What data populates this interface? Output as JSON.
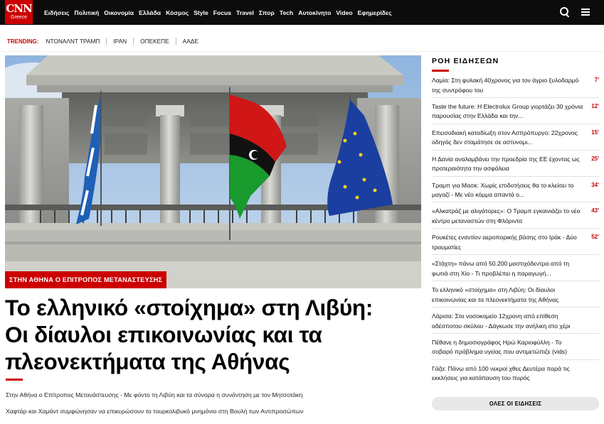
{
  "logo": {
    "brand": "CNN",
    "edition": "Greece"
  },
  "nav": {
    "items": [
      "Ειδήσεις",
      "Πολιτική",
      "Οικονομία",
      "Ελλάδα",
      "Κόσμος",
      "Style",
      "Focus",
      "Travel",
      "Σπορ",
      "Tech",
      "Αυτοκίνητο",
      "Video",
      "Εφημερίδες"
    ]
  },
  "icons": {
    "search": "search-icon",
    "menu": "hamburger-menu-icon"
  },
  "colors": {
    "accent": "#cc0000",
    "nav_bg": "#0c0c0c"
  },
  "trending": {
    "label": "TRENDING:",
    "items": [
      "ΝΤΟΝΑΛΝΤ ΤΡΑΜΠ",
      "ΙΡΑΝ",
      "ΟΠΕΚΕΠΕ",
      "ΑΑΔΕ"
    ]
  },
  "main": {
    "kicker": "ΣΤΗΝ ΑΘΗΝΑ Ο ΕΠΙΤΡΟΠΟΣ ΜΕΤΑΝΑΣΤΕΥΣΗΣ",
    "headline_lines": [
      "Το ελληνικό «στοίχημα» στη Λιβύη:",
      "Οι δίαυλοι επικοινωνίας και τα",
      "πλεονεκτήματα της Αθήνας"
    ],
    "summary_lines": [
      "Στην Αθήνα ο Επίτροπος Μετανάστευσης - Με φόντο τη Λιβύη και τα σύνορα η συνάντηση με τον Μητσοτάκη",
      "Χαφτάρ και Χαμάντ συμφώνησαν να επικυρώσουν το τουρκολιβυκό μνημόνιο στη Βουλή των Αντιπροσώπων"
    ]
  },
  "feed": {
    "title": "ΡΟΗ ΕΙΔΗΣΕΩΝ",
    "items": [
      {
        "text": "Λαμία: Στη φυλακή 40χρονος για τον άγριο ξυλοδαρμό της συντρόφου του",
        "minutes": "7'"
      },
      {
        "text": "Taste the future: Η Electrolux Group γιορτάζει 30 χρόνια παρουσίας στην Ελλάδα και την...",
        "minutes": "12'"
      },
      {
        "text": "Επεισοδιακή καταδίωξη στον Ασπρόπυργο: 22χρονος οδηγός δεν σταμάτησε σε αστυνομι...",
        "minutes": "15'"
      },
      {
        "text": "Η Δανία αναλαμβάνει την προεδρία της ΕΕ έχοντας ως προτεραιότητα την ασφάλεια",
        "minutes": "25'"
      },
      {
        "text": "Τραμπ για Μασκ: Χωρίς επιδοτήσεις θα το κλείσει το μαγαζί - Με νέο κόμμα απαντά ο...",
        "minutes": "34'"
      },
      {
        "text": "«Αλκατράζ με αλιγάτορες»: Ο Τραμπ εγκαινιάζει το νέο κέντρο μεταναστών στη Φλόριντα",
        "minutes": "43'"
      },
      {
        "text": "Ρουκέτες εναντίον αεροπορικής βάσης στο Ιράκ - Δύο τραυματίες",
        "minutes": "52'"
      },
      {
        "text": "«Στάχτη» πάνω από 50.200 μαστιχόδεντρα από τη φωτιά στη Χίο - Τι προβλέπει η παραγωγή...",
        "minutes": ""
      },
      {
        "text": "Το ελληνικό «στοίχημα» στη Λιβύη: Οι δίαυλοι επικοινωνίας και τα πλεονεκτήματα της Αθήνας",
        "minutes": ""
      },
      {
        "text": "Λάρισα: Στο νοσοκομείο 12χρονη από επίθεση αδέσποτου σκύλου - Δάγκωσε την ανήλικη στο χέρι",
        "minutes": ""
      },
      {
        "text": "Πέθανε η δημοσιογράφος Ηρώ Καριοφύλλη - Το σοβαρό πρόβλημα υγείας που αντιμετώπιζε (vids)",
        "minutes": ""
      },
      {
        "text": "Γάζα: Πάνω από 100 νεκροί χθες Δευτέρα παρά τις εκκλήσεις για κατάπαυση του πυρός",
        "minutes": ""
      }
    ],
    "all_news_label": "ΟΛΕΣ ΟΙ ΕΙΔΗΣΕΙΣ"
  }
}
